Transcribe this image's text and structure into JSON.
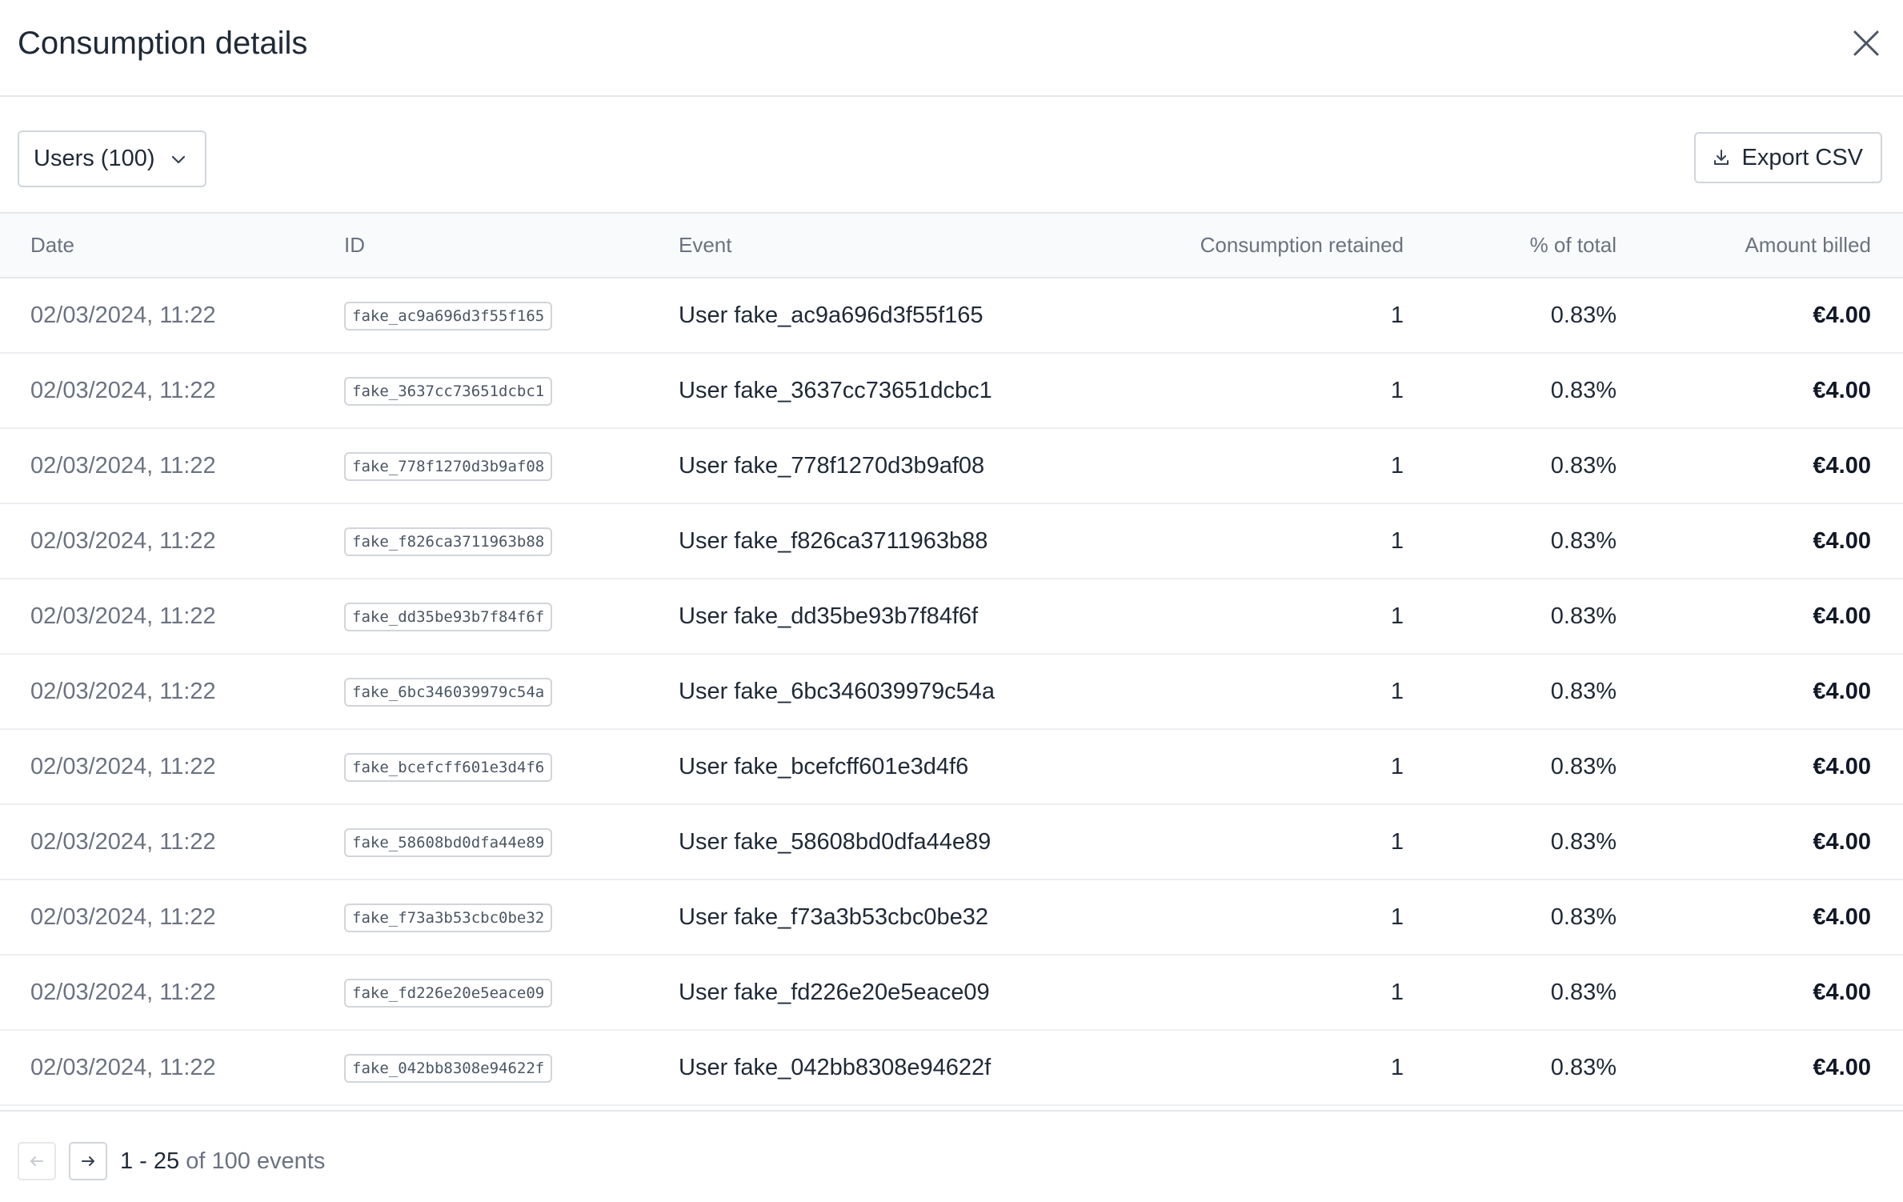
{
  "dialog": {
    "title": "Consumption details",
    "close_label": "Close"
  },
  "toolbar": {
    "filter_label": "Users (100)",
    "export_label": "Export CSV"
  },
  "table": {
    "columns": {
      "date": "Date",
      "id": "ID",
      "event": "Event",
      "consumption": "Consumption retained",
      "percent": "% of total",
      "amount": "Amount billed"
    },
    "rows": [
      {
        "date": "02/03/2024, 11:22",
        "id": "fake_ac9a696d3f55f165",
        "event": "User fake_ac9a696d3f55f165",
        "consumption": "1",
        "percent": "0.83%",
        "amount": "€4.00"
      },
      {
        "date": "02/03/2024, 11:22",
        "id": "fake_3637cc73651dcbc1",
        "event": "User fake_3637cc73651dcbc1",
        "consumption": "1",
        "percent": "0.83%",
        "amount": "€4.00"
      },
      {
        "date": "02/03/2024, 11:22",
        "id": "fake_778f1270d3b9af08",
        "event": "User fake_778f1270d3b9af08",
        "consumption": "1",
        "percent": "0.83%",
        "amount": "€4.00"
      },
      {
        "date": "02/03/2024, 11:22",
        "id": "fake_f826ca3711963b88",
        "event": "User fake_f826ca3711963b88",
        "consumption": "1",
        "percent": "0.83%",
        "amount": "€4.00"
      },
      {
        "date": "02/03/2024, 11:22",
        "id": "fake_dd35be93b7f84f6f",
        "event": "User fake_dd35be93b7f84f6f",
        "consumption": "1",
        "percent": "0.83%",
        "amount": "€4.00"
      },
      {
        "date": "02/03/2024, 11:22",
        "id": "fake_6bc346039979c54a",
        "event": "User fake_6bc346039979c54a",
        "consumption": "1",
        "percent": "0.83%",
        "amount": "€4.00"
      },
      {
        "date": "02/03/2024, 11:22",
        "id": "fake_bcefcff601e3d4f6",
        "event": "User fake_bcefcff601e3d4f6",
        "consumption": "1",
        "percent": "0.83%",
        "amount": "€4.00"
      },
      {
        "date": "02/03/2024, 11:22",
        "id": "fake_58608bd0dfa44e89",
        "event": "User fake_58608bd0dfa44e89",
        "consumption": "1",
        "percent": "0.83%",
        "amount": "€4.00"
      },
      {
        "date": "02/03/2024, 11:22",
        "id": "fake_f73a3b53cbc0be32",
        "event": "User fake_f73a3b53cbc0be32",
        "consumption": "1",
        "percent": "0.83%",
        "amount": "€4.00"
      },
      {
        "date": "02/03/2024, 11:22",
        "id": "fake_fd226e20e5eace09",
        "event": "User fake_fd226e20e5eace09",
        "consumption": "1",
        "percent": "0.83%",
        "amount": "€4.00"
      },
      {
        "date": "02/03/2024, 11:22",
        "id": "fake_042bb8308e94622f",
        "event": "User fake_042bb8308e94622f",
        "consumption": "1",
        "percent": "0.83%",
        "amount": "€4.00"
      }
    ]
  },
  "pagination": {
    "range": "1 - 25",
    "rest": " of 100 events"
  },
  "icons": {
    "close": "close-icon",
    "chevron": "chevron-down-icon",
    "download": "download-icon",
    "prev": "arrow-left-icon",
    "next": "arrow-right-icon"
  },
  "colors": {
    "border": "#e5e7eb",
    "header_bg": "#f9fafb",
    "text": "#1f2937",
    "muted": "#6b7280"
  }
}
